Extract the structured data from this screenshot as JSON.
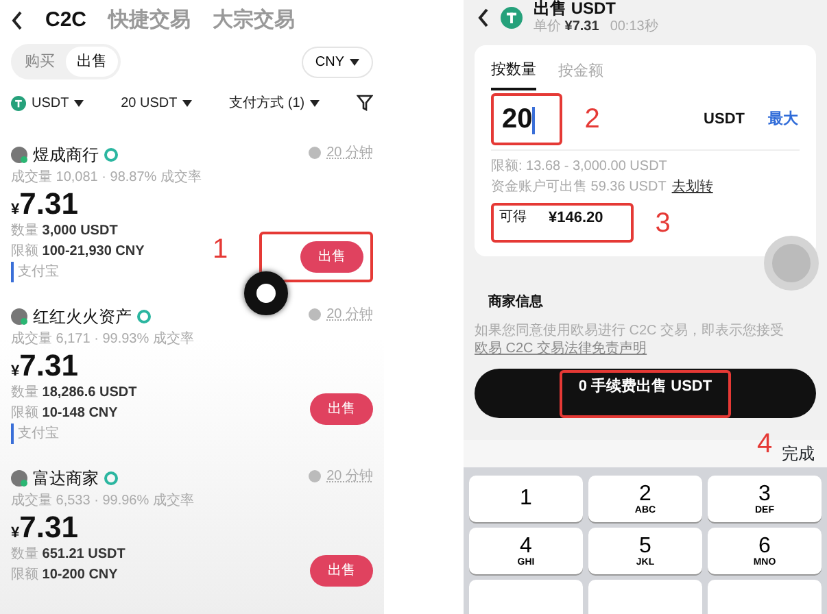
{
  "left": {
    "tabs": [
      {
        "label": "C2C",
        "selected": true
      },
      {
        "label": "快捷交易",
        "selected": false
      },
      {
        "label": "大宗交易",
        "selected": false
      }
    ],
    "sides": [
      {
        "label": "购买",
        "selected": false
      },
      {
        "label": "出售",
        "selected": true
      }
    ],
    "currency": "CNY",
    "filters": [
      {
        "label": "USDT",
        "kind": "coin"
      },
      {
        "label": "20 USDT",
        "kind": "plain"
      },
      {
        "label": "支付方式 (1)",
        "kind": "plain"
      }
    ],
    "merchants": [
      {
        "name": "煜成商行",
        "stats": "成交量 10,081 · 98.87% 成交率",
        "time": "20 分钟",
        "currency_sign": "¥",
        "price": "7.31",
        "quantity_label": "数量",
        "quantity": "3,000 USDT",
        "limit_label": "限额",
        "limit": "100-21,930 CNY",
        "payment": "支付宝",
        "action": "出售",
        "annotation": "1"
      },
      {
        "name": "红红火火资产",
        "stats": "成交量 6,171 · 99.93% 成交率",
        "time": "20 分钟",
        "currency_sign": "¥",
        "price": "7.31",
        "quantity_label": "数量",
        "quantity": "18,286.6 USDT",
        "limit_label": "限额",
        "limit": "10-148 CNY",
        "payment": "支付宝",
        "action": "出售"
      },
      {
        "name": "富达商家",
        "stats": "成交量 6,533 · 99.96% 成交率",
        "time": "20 分钟",
        "currency_sign": "¥",
        "price": "7.31",
        "quantity_label": "数量",
        "quantity": "651.21 USDT",
        "limit_label": "限额",
        "limit": "10-200 CNY",
        "action": "出售"
      }
    ]
  },
  "right": {
    "title": "出售 USDT",
    "unit_label": "单价",
    "unit_price": "¥7.31",
    "countdown": "00:13秒",
    "modes": [
      {
        "label": "按数量",
        "selected": true
      },
      {
        "label": "按金额",
        "selected": false
      }
    ],
    "amount": "20",
    "amount_unit": "USDT",
    "max": "最大",
    "amount_annotation": "2",
    "limit": "限额: 13.68 - 3,000.00 USDT",
    "available": "资金账户可出售 59.36 USDT",
    "transfer": "去划转",
    "receive_label": "可得",
    "receive": "¥146.20",
    "receive_annotation": "3",
    "merchant_heading": "商家信息",
    "disclaimer": "如果您同意使用欧易进行 C2C 交易，即表示您接受",
    "disclaimer_link": "欧易 C2C 交易法律免责声明",
    "submit": "0 手续费出售 USDT",
    "submit_annotation": "4",
    "done": "完成",
    "keys": [
      {
        "digit": "1"
      },
      {
        "digit": "2",
        "letters": "ABC"
      },
      {
        "digit": "3",
        "letters": "DEF"
      },
      {
        "digit": "4",
        "letters": "GHI"
      },
      {
        "digit": "5",
        "letters": "JKL"
      },
      {
        "digit": "6",
        "letters": "MNO"
      }
    ]
  }
}
